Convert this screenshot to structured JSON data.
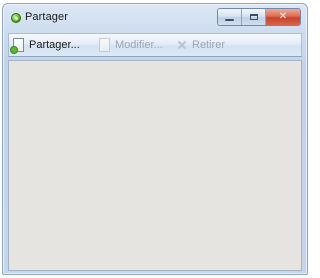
{
  "window": {
    "title": "Partager"
  },
  "caption_buttons": {
    "minimize_icon": "minimize-icon",
    "maximize_icon": "maximize-icon",
    "close_icon": "close-icon",
    "close_glyph": "✕"
  },
  "toolbar": {
    "share_label": "Partager...",
    "edit_label": "Modifier...",
    "remove_label": "Retirer",
    "share_enabled": true,
    "edit_enabled": false,
    "remove_enabled": false
  },
  "colors": {
    "accent_close": "#c8442a",
    "frame": "#c6d6ea",
    "content_background": "#e6e4e1",
    "disabled_text": "#9aa6b3"
  }
}
